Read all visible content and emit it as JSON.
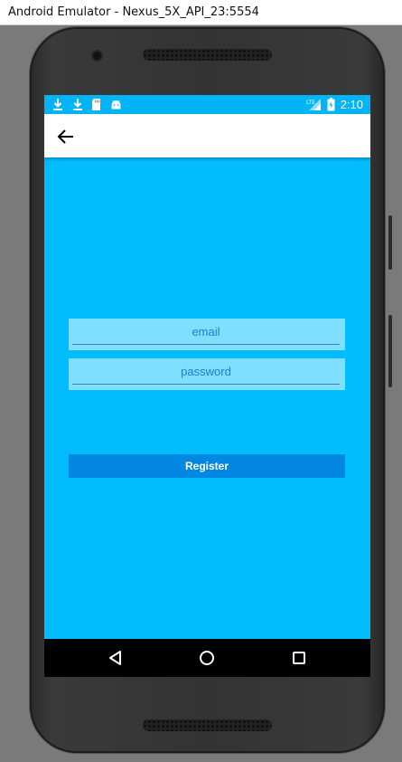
{
  "window": {
    "title": "Android Emulator - Nexus_5X_API_23:5554"
  },
  "status_bar": {
    "time": "2:10",
    "icons": [
      "download-icon",
      "download-icon",
      "sd-card-icon",
      "android-icon",
      "signal-lte-icon",
      "battery-charging-icon"
    ]
  },
  "app_bar": {
    "back_icon": "arrow-back-icon"
  },
  "form": {
    "email_placeholder": "email",
    "email_value": "",
    "password_placeholder": "password",
    "password_value": "",
    "register_label": "Register"
  },
  "nav_bar": {
    "icons": [
      "back-triangle-icon",
      "home-circle-icon",
      "recents-square-icon"
    ]
  },
  "colors": {
    "screen_bg": "#01bdfe",
    "status_bg": "#01b4f5",
    "field_bg": "#80deff",
    "button_bg": "#0288e2"
  }
}
